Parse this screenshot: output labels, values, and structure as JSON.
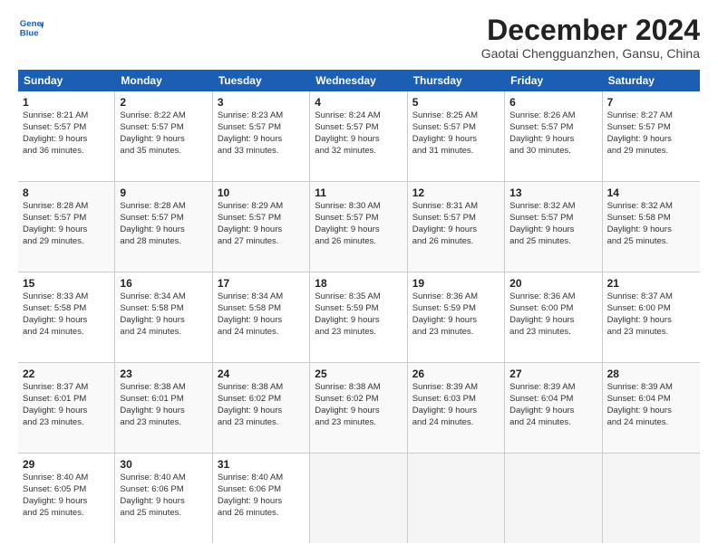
{
  "logo": {
    "line1": "General",
    "line2": "Blue"
  },
  "title": "December 2024",
  "subtitle": "Gaotai Chengguanzhen, Gansu, China",
  "days_of_week": [
    "Sunday",
    "Monday",
    "Tuesday",
    "Wednesday",
    "Thursday",
    "Friday",
    "Saturday"
  ],
  "weeks": [
    [
      {
        "day": "1",
        "info": "Sunrise: 8:21 AM\nSunset: 5:57 PM\nDaylight: 9 hours\nand 36 minutes."
      },
      {
        "day": "2",
        "info": "Sunrise: 8:22 AM\nSunset: 5:57 PM\nDaylight: 9 hours\nand 35 minutes."
      },
      {
        "day": "3",
        "info": "Sunrise: 8:23 AM\nSunset: 5:57 PM\nDaylight: 9 hours\nand 33 minutes."
      },
      {
        "day": "4",
        "info": "Sunrise: 8:24 AM\nSunset: 5:57 PM\nDaylight: 9 hours\nand 32 minutes."
      },
      {
        "day": "5",
        "info": "Sunrise: 8:25 AM\nSunset: 5:57 PM\nDaylight: 9 hours\nand 31 minutes."
      },
      {
        "day": "6",
        "info": "Sunrise: 8:26 AM\nSunset: 5:57 PM\nDaylight: 9 hours\nand 30 minutes."
      },
      {
        "day": "7",
        "info": "Sunrise: 8:27 AM\nSunset: 5:57 PM\nDaylight: 9 hours\nand 29 minutes."
      }
    ],
    [
      {
        "day": "8",
        "info": "Sunrise: 8:28 AM\nSunset: 5:57 PM\nDaylight: 9 hours\nand 29 minutes."
      },
      {
        "day": "9",
        "info": "Sunrise: 8:28 AM\nSunset: 5:57 PM\nDaylight: 9 hours\nand 28 minutes."
      },
      {
        "day": "10",
        "info": "Sunrise: 8:29 AM\nSunset: 5:57 PM\nDaylight: 9 hours\nand 27 minutes."
      },
      {
        "day": "11",
        "info": "Sunrise: 8:30 AM\nSunset: 5:57 PM\nDaylight: 9 hours\nand 26 minutes."
      },
      {
        "day": "12",
        "info": "Sunrise: 8:31 AM\nSunset: 5:57 PM\nDaylight: 9 hours\nand 26 minutes."
      },
      {
        "day": "13",
        "info": "Sunrise: 8:32 AM\nSunset: 5:57 PM\nDaylight: 9 hours\nand 25 minutes."
      },
      {
        "day": "14",
        "info": "Sunrise: 8:32 AM\nSunset: 5:58 PM\nDaylight: 9 hours\nand 25 minutes."
      }
    ],
    [
      {
        "day": "15",
        "info": "Sunrise: 8:33 AM\nSunset: 5:58 PM\nDaylight: 9 hours\nand 24 minutes."
      },
      {
        "day": "16",
        "info": "Sunrise: 8:34 AM\nSunset: 5:58 PM\nDaylight: 9 hours\nand 24 minutes."
      },
      {
        "day": "17",
        "info": "Sunrise: 8:34 AM\nSunset: 5:58 PM\nDaylight: 9 hours\nand 24 minutes."
      },
      {
        "day": "18",
        "info": "Sunrise: 8:35 AM\nSunset: 5:59 PM\nDaylight: 9 hours\nand 23 minutes."
      },
      {
        "day": "19",
        "info": "Sunrise: 8:36 AM\nSunset: 5:59 PM\nDaylight: 9 hours\nand 23 minutes."
      },
      {
        "day": "20",
        "info": "Sunrise: 8:36 AM\nSunset: 6:00 PM\nDaylight: 9 hours\nand 23 minutes."
      },
      {
        "day": "21",
        "info": "Sunrise: 8:37 AM\nSunset: 6:00 PM\nDaylight: 9 hours\nand 23 minutes."
      }
    ],
    [
      {
        "day": "22",
        "info": "Sunrise: 8:37 AM\nSunset: 6:01 PM\nDaylight: 9 hours\nand 23 minutes."
      },
      {
        "day": "23",
        "info": "Sunrise: 8:38 AM\nSunset: 6:01 PM\nDaylight: 9 hours\nand 23 minutes."
      },
      {
        "day": "24",
        "info": "Sunrise: 8:38 AM\nSunset: 6:02 PM\nDaylight: 9 hours\nand 23 minutes."
      },
      {
        "day": "25",
        "info": "Sunrise: 8:38 AM\nSunset: 6:02 PM\nDaylight: 9 hours\nand 23 minutes."
      },
      {
        "day": "26",
        "info": "Sunrise: 8:39 AM\nSunset: 6:03 PM\nDaylight: 9 hours\nand 24 minutes."
      },
      {
        "day": "27",
        "info": "Sunrise: 8:39 AM\nSunset: 6:04 PM\nDaylight: 9 hours\nand 24 minutes."
      },
      {
        "day": "28",
        "info": "Sunrise: 8:39 AM\nSunset: 6:04 PM\nDaylight: 9 hours\nand 24 minutes."
      }
    ],
    [
      {
        "day": "29",
        "info": "Sunrise: 8:40 AM\nSunset: 6:05 PM\nDaylight: 9 hours\nand 25 minutes."
      },
      {
        "day": "30",
        "info": "Sunrise: 8:40 AM\nSunset: 6:06 PM\nDaylight: 9 hours\nand 25 minutes."
      },
      {
        "day": "31",
        "info": "Sunrise: 8:40 AM\nSunset: 6:06 PM\nDaylight: 9 hours\nand 26 minutes."
      },
      {
        "day": "",
        "info": ""
      },
      {
        "day": "",
        "info": ""
      },
      {
        "day": "",
        "info": ""
      },
      {
        "day": "",
        "info": ""
      }
    ]
  ]
}
